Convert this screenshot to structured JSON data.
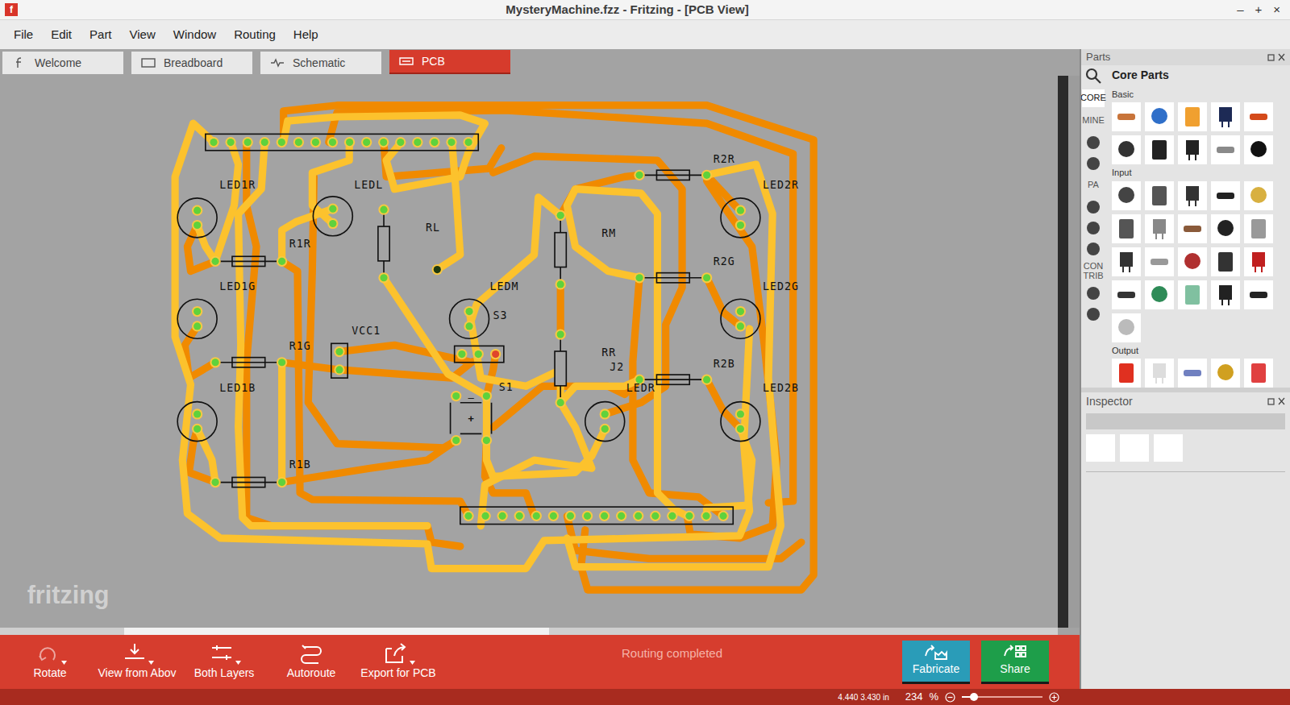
{
  "window": {
    "logo": "f",
    "title": "MysteryMachine.fzz - Fritzing - [PCB View]",
    "controls": [
      "–",
      "+",
      "×"
    ]
  },
  "menu": [
    "File",
    "Edit",
    "Part",
    "View",
    "Window",
    "Routing",
    "Help"
  ],
  "tabs": [
    {
      "label": "Welcome",
      "selected": false
    },
    {
      "label": "Breadboard",
      "selected": false
    },
    {
      "label": "Schematic",
      "selected": false
    },
    {
      "label": "PCB",
      "selected": true
    }
  ],
  "canvas": {
    "watermark": "fritzing",
    "labels": [
      "LED1R",
      "LEDL",
      "RL",
      "R1R",
      "LED1G",
      "R1G",
      "VCC1",
      "LEDM",
      "S3",
      "RM",
      "R2R",
      "LED2R",
      "R2G",
      "LED2G",
      "RR",
      "J2",
      "LEDR",
      "R2B",
      "LED2B",
      "S1",
      "LED1B",
      "R1B"
    ],
    "cap_marks": [
      "–",
      "+"
    ],
    "h_scroll": {
      "offset": 0.117,
      "level": 0.402
    }
  },
  "toolbar": {
    "buttons": [
      {
        "label": "Rotate",
        "has_menu": true
      },
      {
        "label": "View from Abov",
        "has_menu": true
      },
      {
        "label": "Both Layers",
        "has_menu": true
      },
      {
        "label": "Autoroute",
        "has_menu": false
      },
      {
        "label": "Export for PCB",
        "has_menu": true
      }
    ],
    "status": "Routing completed",
    "actions": [
      {
        "label": "Fabricate",
        "color": "#2a9cb8"
      },
      {
        "label": "Share",
        "color": "#1e9e4a"
      }
    ]
  },
  "parts": {
    "title": "Parts",
    "bin": "Core Parts",
    "bins": [
      {
        "kind": "text",
        "label": "CORE",
        "selected": true
      },
      {
        "kind": "text",
        "label": "MINE",
        "selected": false
      },
      {
        "kind": "icon",
        "selected": false
      },
      {
        "kind": "icon",
        "selected": false
      },
      {
        "kind": "text",
        "label": "PA",
        "selected": false
      },
      {
        "kind": "icon",
        "selected": false
      },
      {
        "kind": "icon",
        "selected": false
      },
      {
        "kind": "icon",
        "selected": false
      },
      {
        "kind": "text",
        "label": "CON TRIB",
        "selected": false
      },
      {
        "kind": "icon",
        "selected": false
      },
      {
        "kind": "icon",
        "selected": false
      }
    ],
    "sections": [
      "Basic",
      "Input",
      "Output"
    ]
  },
  "inspector": {
    "title": "Inspector"
  },
  "status_bar": {
    "coords": "4.440 3.430 in",
    "zoom": "234",
    "unit": "%",
    "zoom_level": 0.15
  }
}
